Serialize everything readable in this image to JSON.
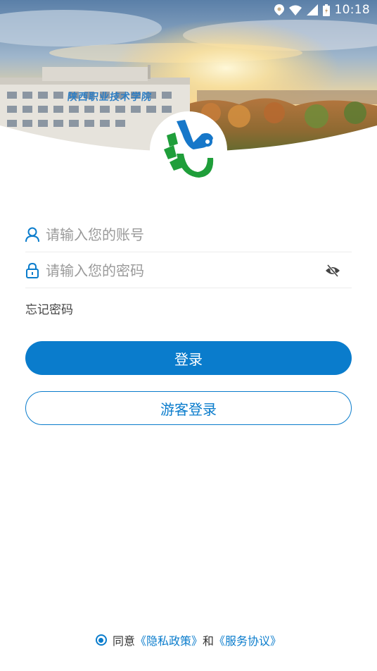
{
  "status_bar": {
    "time": "10:18",
    "icons": [
      "location-icon",
      "wifi-icon",
      "signal-icon",
      "battery-icon"
    ]
  },
  "banner": {
    "campus_sign": "陕西职业技术学院"
  },
  "login_form": {
    "account_placeholder": "请输入您的账号",
    "password_placeholder": "请输入您的密码",
    "forgot_password": "忘记密码",
    "login_button": "登录",
    "guest_login_button": "游客登录"
  },
  "agreement": {
    "agree_text": "同意",
    "privacy_link": "《隐私政策》",
    "and_text": "和",
    "service_link": "《服务协议》"
  },
  "colors": {
    "accent": "#0a7ccc",
    "logo_green": "#1f9e3a",
    "logo_blue": "#1677c9"
  }
}
